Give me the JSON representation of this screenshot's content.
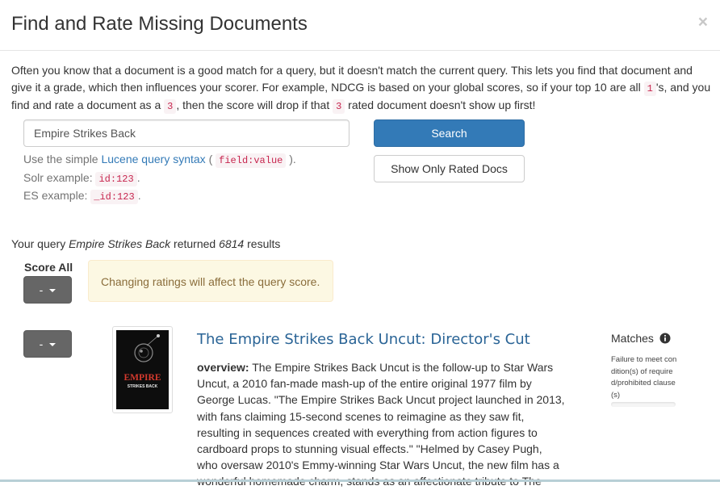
{
  "modal": {
    "title": "Find and Rate Missing Documents",
    "close": "×"
  },
  "intro": {
    "p1": "Often you know that a document is a good match for a query, but it doesn't match the current query. This lets you find that document and give it a grade, which then influences your scorer. For example, NDCG is based on your global scores, so if your top 10 are all ",
    "code1": "1",
    "p2": "'s, and you find and rate a document as a ",
    "code2": "3",
    "p3": ", then the score will drop if that ",
    "code3": "3",
    "p4": " rated document doesn't show up first!"
  },
  "search": {
    "value": "Empire Strikes Back",
    "button": "Search",
    "rated_button": "Show Only Rated Docs"
  },
  "help": {
    "line1_pre": "Use the simple ",
    "line1_link": "Lucene query syntax",
    "line1_mid": " ( ",
    "line1_code": "field:value",
    "line1_post": " ).",
    "line2_pre": "Solr example: ",
    "line2_code": "id:123",
    "line2_post": ".",
    "line3_pre": "ES example: ",
    "line3_code": "_id:123",
    "line3_post": "."
  },
  "results": {
    "pre": "Your query ",
    "query": "Empire Strikes Back",
    "mid": " returned ",
    "count": "6814",
    "post": " results"
  },
  "score_all": {
    "label": "Score All",
    "value": "-"
  },
  "warning": "Changing ratings will affect the query score.",
  "doc": {
    "rating": "-",
    "title": "The Empire Strikes Back Uncut: Director's Cut",
    "overview_label": "overview:",
    "overview_text": " The Empire Strikes Back Uncut is the follow-up to Star Wars Uncut, a 2010 fan-made mash-up of the entire original 1977 film by George Lucas. \"The Empire Strikes Back Uncut project launched in 2013, with fans claiming 15-second scenes to reimagine as they saw fit, resulting in sequences created with everything from action figures to cardboard props to stunning visual effects.\" \"Helmed by Casey Pugh, who oversaw 2010's Emmy-winning Star Wars Uncut, the new film has a wonderful homemade charm, stands as an affectionate tribute to The",
    "poster_line1": "EMPIRE",
    "poster_line2": "STRIKES BACK",
    "matches_label": "Matches",
    "matches_detail": "Failure to meet condition(s) of required/prohibited clause(s)",
    "match_score": 0
  },
  "colors": {
    "primary": "#337ab7",
    "warning_bg": "#fcf8e3",
    "warning_text": "#8a6d3b",
    "title_link": "#2a6496",
    "code_text": "#c7254e"
  },
  "icons": [
    "close-icon",
    "caret-down-icon",
    "info-circle-icon"
  ]
}
